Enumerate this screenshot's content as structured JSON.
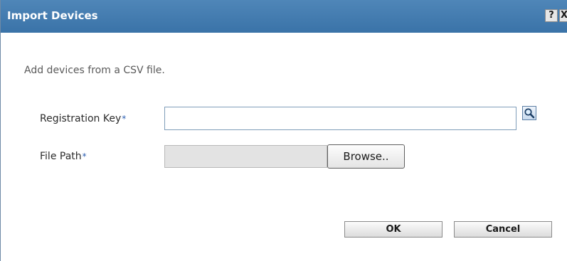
{
  "dialog": {
    "title": "Import Devices",
    "help_label": "?",
    "close_label": "X",
    "description": "Add devices from a CSV file."
  },
  "form": {
    "registration_key": {
      "label": "Registration Key",
      "required_marker": "*",
      "value": "",
      "lookup_icon": "magnifier-icon"
    },
    "file_path": {
      "label": "File Path",
      "required_marker": "*",
      "value": "",
      "browse_label": "Browse.."
    }
  },
  "actions": {
    "ok_label": "OK",
    "cancel_label": "Cancel"
  },
  "colors": {
    "titlebar": "#3a73a8",
    "required_marker": "#2a5db0",
    "disabled_field": "#e3e3e3"
  }
}
